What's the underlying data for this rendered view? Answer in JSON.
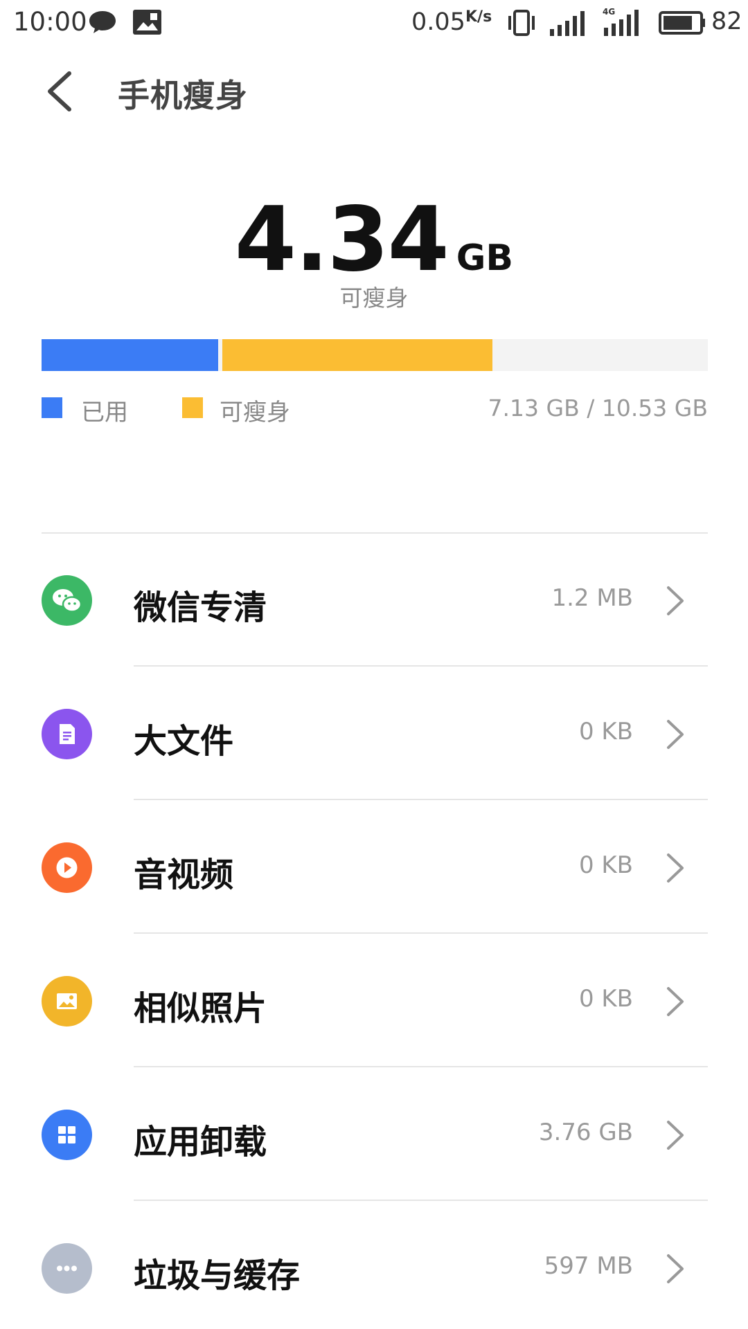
{
  "status_bar": {
    "time": "10:00",
    "net_speed": "0.05",
    "net_speed_unit": "K/s",
    "signal_label": "4G",
    "battery": "82",
    "icons": [
      "chat-icon",
      "gallery-icon",
      "vibrate-icon",
      "signal-icon",
      "signal-4g-icon",
      "battery-icon"
    ]
  },
  "header": {
    "title": "手机瘦身",
    "back_icon": "chevron-left-icon"
  },
  "summary": {
    "amount": "4.34",
    "unit": "GB",
    "label": "可瘦身"
  },
  "storage": {
    "used_gb": 2.79,
    "slimmable_gb": 4.34,
    "total_gb": 10.53,
    "colors": {
      "used": "#3b7cf5",
      "slimmable": "#fbbd33",
      "free": "#f3f3f3"
    },
    "legend_used": "已用",
    "legend_slimmable": "可瘦身",
    "total_text": "7.13 GB / 10.53 GB"
  },
  "items": [
    {
      "label": "微信专清",
      "size": "1.2 MB",
      "icon": "wechat-icon",
      "color": "#3cb866"
    },
    {
      "label": "大文件",
      "size": "0 KB",
      "icon": "document-icon",
      "color": "#8b55ee"
    },
    {
      "label": "音视频",
      "size": "0 KB",
      "icon": "play-icon",
      "color": "#fa6a2f"
    },
    {
      "label": "相似照片",
      "size": "0 KB",
      "icon": "photo-icon",
      "color": "#f2b52a"
    },
    {
      "label": "应用卸载",
      "size": "3.76 GB",
      "icon": "apps-grid-icon",
      "color": "#3b7cf5"
    },
    {
      "label": "垃圾与缓存",
      "size": "597 MB",
      "icon": "more-dots-icon",
      "color": "#b5bdcc"
    }
  ]
}
